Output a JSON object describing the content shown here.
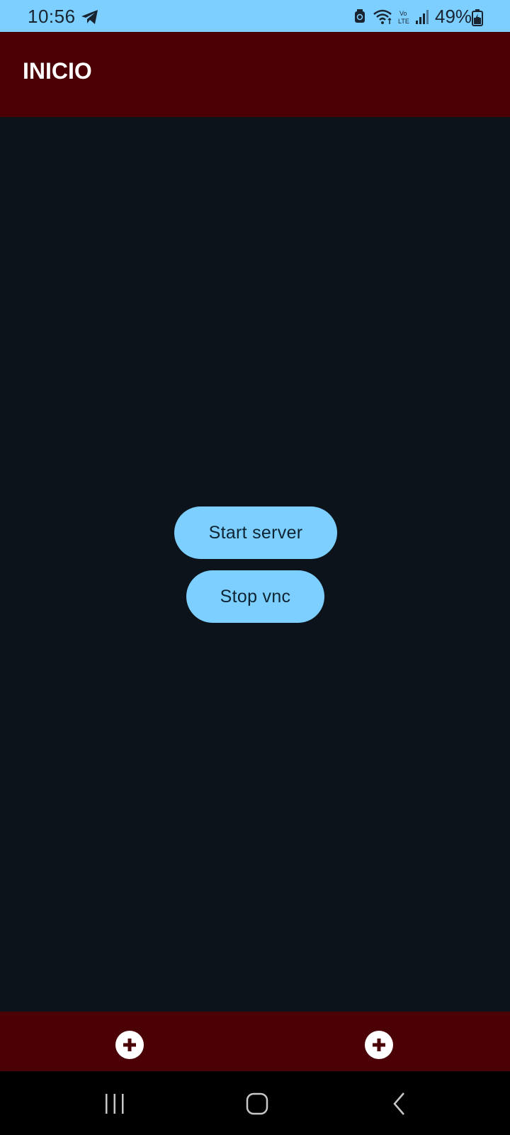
{
  "status_bar": {
    "time": "10:56",
    "battery_percent": "49%",
    "icons": [
      "telegram-icon",
      "alarm-icon",
      "wifi-icon",
      "volte-icon",
      "signal-icon",
      "battery-icon"
    ]
  },
  "app_bar": {
    "title": "INICIO"
  },
  "main": {
    "start_button_label": "Start server",
    "stop_button_label": "Stop vnc"
  },
  "bottom_bar": {
    "left_icon": "add-icon",
    "right_icon": "add-icon"
  },
  "nav_bar": {
    "icons": [
      "recents-icon",
      "home-icon",
      "back-icon"
    ]
  },
  "colors": {
    "status_bar": "#7dcfff",
    "app_bar": "#4a0004",
    "background": "#0d131a",
    "button": "#7dcfff",
    "nav_bar": "#000000"
  }
}
